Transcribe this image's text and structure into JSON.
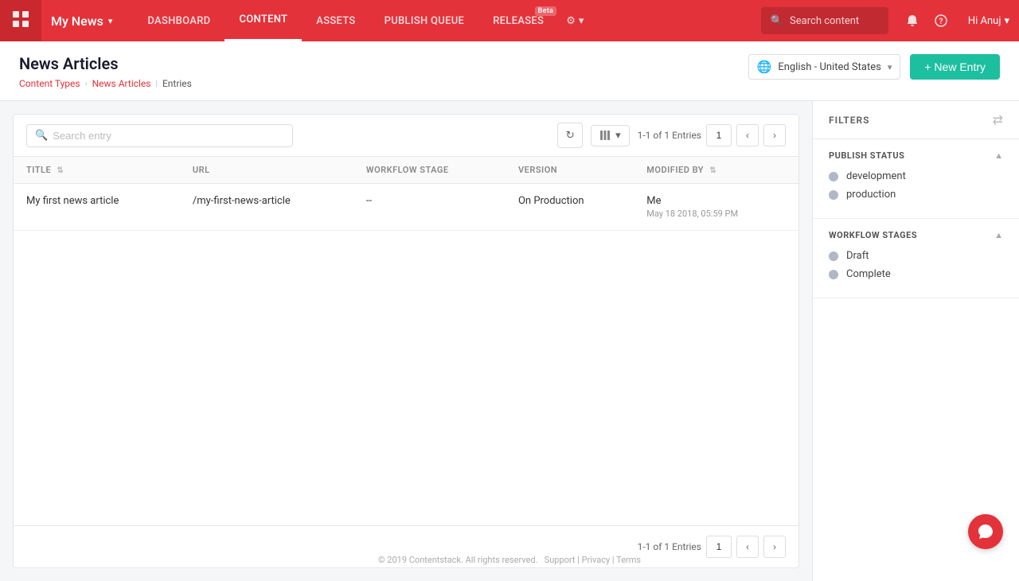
{
  "app": {
    "brand": "My News",
    "beta_label": "Beta"
  },
  "nav": {
    "links": [
      {
        "id": "dashboard",
        "label": "DASHBOARD",
        "active": false,
        "beta": false
      },
      {
        "id": "content",
        "label": "CONTENT",
        "active": true,
        "beta": false
      },
      {
        "id": "assets",
        "label": "ASSETS",
        "active": false,
        "beta": false
      },
      {
        "id": "publish-queue",
        "label": "PUBLISH QUEUE",
        "active": false,
        "beta": false
      },
      {
        "id": "releases",
        "label": "RELEASES",
        "active": false,
        "beta": true
      }
    ],
    "search_placeholder": "Search content",
    "user": "Hi Anuj"
  },
  "page": {
    "title": "News Articles",
    "breadcrumb": {
      "content_types": "Content Types",
      "news_articles": "News Articles",
      "entries": "Entries"
    },
    "language_selector": "English - United States",
    "new_entry_button": "+ New Entry"
  },
  "toolbar": {
    "search_placeholder": "Search entry",
    "page_info": "1-1 of 1 Entries",
    "current_page": "1",
    "refresh_icon": "↻",
    "prev_icon": "‹",
    "next_icon": "›"
  },
  "table": {
    "columns": [
      {
        "id": "title",
        "label": "TITLE",
        "sortable": true
      },
      {
        "id": "url",
        "label": "URL",
        "sortable": false
      },
      {
        "id": "workflow_stage",
        "label": "WORKFLOW STAGE",
        "sortable": false
      },
      {
        "id": "version",
        "label": "VERSION",
        "sortable": false
      },
      {
        "id": "modified_by",
        "label": "MODIFIED BY",
        "sortable": true
      }
    ],
    "rows": [
      {
        "title": "My first news article",
        "url": "/my-first-news-article",
        "workflow_stage": "--",
        "version": "On Production",
        "modified_by_name": "Me",
        "modified_by_date": "May 18 2018, 05:59 PM"
      }
    ]
  },
  "bottom_pagination": {
    "page_info": "1-1 of 1 Entries",
    "current_page": "1",
    "prev_icon": "‹",
    "next_icon": "›"
  },
  "filters": {
    "title": "FILTERS",
    "toggle_icon": "⇄",
    "sections": [
      {
        "id": "publish_status",
        "title": "PUBLISH STATUS",
        "collapsed": false,
        "items": [
          {
            "label": "development",
            "color": "#aab0bc"
          },
          {
            "label": "production",
            "color": "#aab0bc"
          }
        ]
      },
      {
        "id": "workflow_stages",
        "title": "WORKFLOW STAGES",
        "collapsed": false,
        "items": [
          {
            "label": "Draft",
            "color": "#aab0bc"
          },
          {
            "label": "Complete",
            "color": "#aab0bc"
          }
        ]
      }
    ]
  },
  "footer": {
    "text": "© 2019 Contentstack. All rights reserved.",
    "support": "Support",
    "privacy": "Privacy",
    "terms": "Terms"
  }
}
